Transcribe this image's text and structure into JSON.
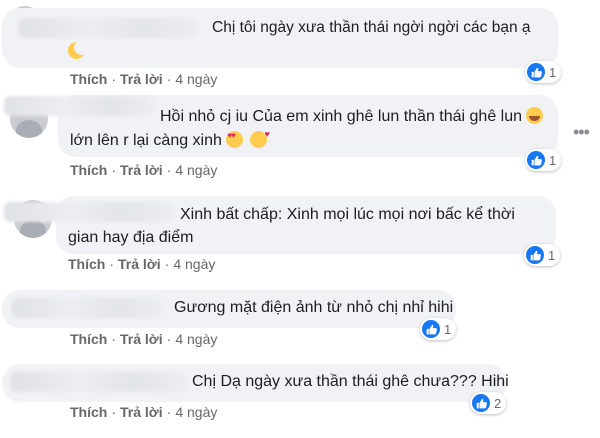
{
  "comments": [
    {
      "text": [
        "Chị tôi ngày xưa thần thái ngời ngời các bạn ạ"
      ],
      "emojis": [
        "moon"
      ],
      "actions": {
        "like": "Thích",
        "reply": "Trả lời",
        "time": "4 ngày"
      },
      "reactions": {
        "icon": "thumbs-up-icon",
        "count": "1"
      }
    },
    {
      "text": [
        "Hồi nhỏ cj iu Của em xinh ghê lun thần thái ghê lun",
        "lớn lên r lại càng xinh"
      ],
      "emojis": [
        "laugh",
        "hearteyes",
        "kiss"
      ],
      "actions": {
        "like": "Thích",
        "reply": "Trả lời",
        "time": "4 ngày"
      },
      "reactions": {
        "icon": "thumbs-up-icon",
        "count": "1"
      }
    },
    {
      "text": [
        "Xinh bất chấp: Xinh mọi lúc mọi nơi bấc kể thời",
        "gian hay địa điểm"
      ],
      "emojis": [],
      "actions": {
        "like": "Thích",
        "reply": "Trả lời",
        "time": "4 ngày"
      },
      "reactions": {
        "icon": "thumbs-up-icon",
        "count": "1"
      }
    },
    {
      "text": [
        "Gương mặt điện ảnh từ nhỏ chị nhỉ hihi"
      ],
      "emojis": [],
      "actions": {
        "like": "Thích",
        "reply": "Trả lời",
        "time": "4 ngày"
      },
      "reactions": {
        "icon": "thumbs-up-icon",
        "count": "1"
      }
    },
    {
      "text": [
        "Chị Dạ ngày xưa thần thái ghê chưa??? Hihi"
      ],
      "emojis": [],
      "actions": {
        "like": "Thích",
        "reply": "Trả lời",
        "time": "4 ngày"
      },
      "reactions": {
        "icon": "thumbs-up-icon",
        "count": "2"
      }
    }
  ],
  "colors": {
    "bubble": "#f0f2f5",
    "like_blue": "#1877f2",
    "meta_gray": "#65676b"
  }
}
